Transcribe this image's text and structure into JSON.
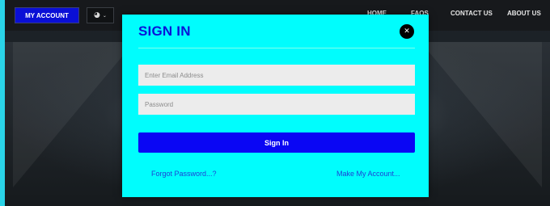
{
  "header": {
    "my_account_label": "MY ACCOUNT",
    "user_icon": "user-circle-icon",
    "nav": [
      "HOME",
      "FAQS",
      "CONTACT US",
      "ABOUT US"
    ]
  },
  "modal": {
    "title": "SIGN IN",
    "close_icon": "close-icon",
    "email_placeholder": "Enter Email Address",
    "password_placeholder": "Password",
    "submit_label": "Sign In",
    "forgot_link": "Forgot Password...?",
    "create_link": "Make My Account..."
  },
  "colors": {
    "modal_bg": "#00fdfd",
    "accent": "#0a06f4"
  }
}
